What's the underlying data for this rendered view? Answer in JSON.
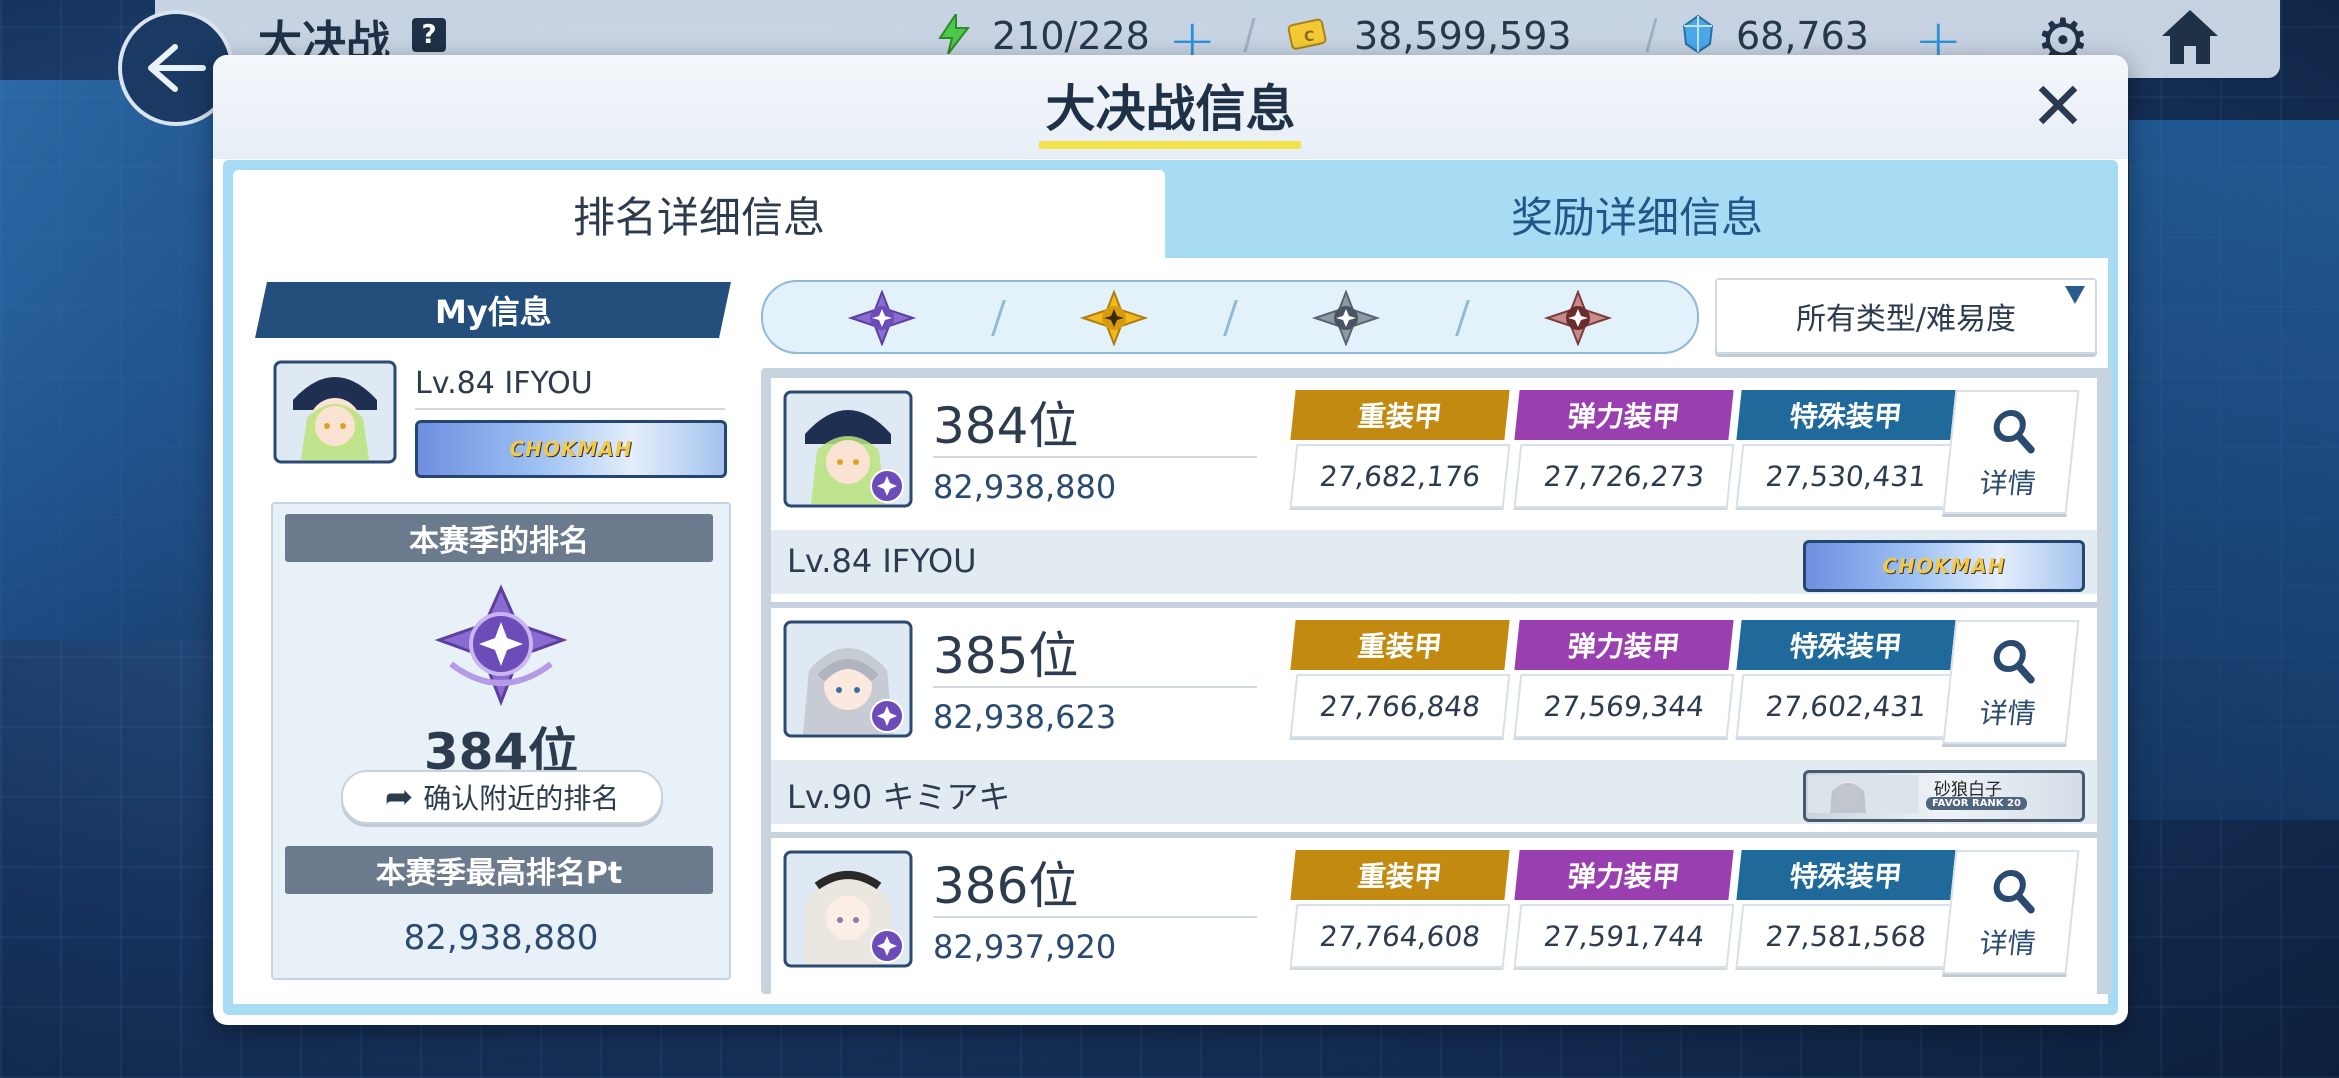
{
  "topbar": {
    "title": "大决战",
    "help": "?",
    "ap": "210/228",
    "credits": "38,599,593",
    "gems": "68,763"
  },
  "modal": {
    "title": "大决战信息",
    "close": "✕",
    "tabs": [
      {
        "label": "排名详细信息",
        "active": true
      },
      {
        "label": "奖励详细信息",
        "active": false
      }
    ]
  },
  "my_info": {
    "header": "My信息",
    "level_name": "Lv.84 IFYOU",
    "badge_text": "CHOKMAH",
    "season_rank_label": "本赛季的排名",
    "season_rank": "384位",
    "nearby_button": "确认附近的排名",
    "best_pt_label": "本赛季最高排名Pt",
    "best_pt": "82,938,880"
  },
  "filter": {
    "icons": [
      "purple-rank-icon",
      "gold-rank-icon",
      "silver-rank-icon",
      "bronze-rank-icon"
    ],
    "dropdown_value": "所有类型/难易度"
  },
  "armor_colors": {
    "heavy": "#c38a12",
    "elastic": "#9a3fb0",
    "special": "#1f6a9a"
  },
  "ranking": [
    {
      "rank": "384位",
      "score": "82,938,880",
      "heavy_label": "重装甲",
      "heavy": "27,682,176",
      "elastic_label": "弹力装甲",
      "elastic": "27,726,273",
      "special_label": "特殊装甲",
      "special": "27,530,431",
      "detail": "详情",
      "name": "Lv.84  IFYOU",
      "badge": "CHOKMAH"
    },
    {
      "rank": "385位",
      "score": "82,938,623",
      "heavy_label": "重装甲",
      "heavy": "27,766,848",
      "elastic_label": "弹力装甲",
      "elastic": "27,569,344",
      "special_label": "特殊装甲",
      "special": "27,602,431",
      "detail": "详情",
      "name": "Lv.90  キミアキ",
      "badge_name": "砂狼白子",
      "badge_rank": "FAVOR RANK 20"
    },
    {
      "rank": "386位",
      "score": "82,937,920",
      "heavy_label": "重装甲",
      "heavy": "27,764,608",
      "elastic_label": "弹力装甲",
      "elastic": "27,591,744",
      "special_label": "特殊装甲",
      "special": "27,581,568",
      "detail": "详情"
    }
  ]
}
